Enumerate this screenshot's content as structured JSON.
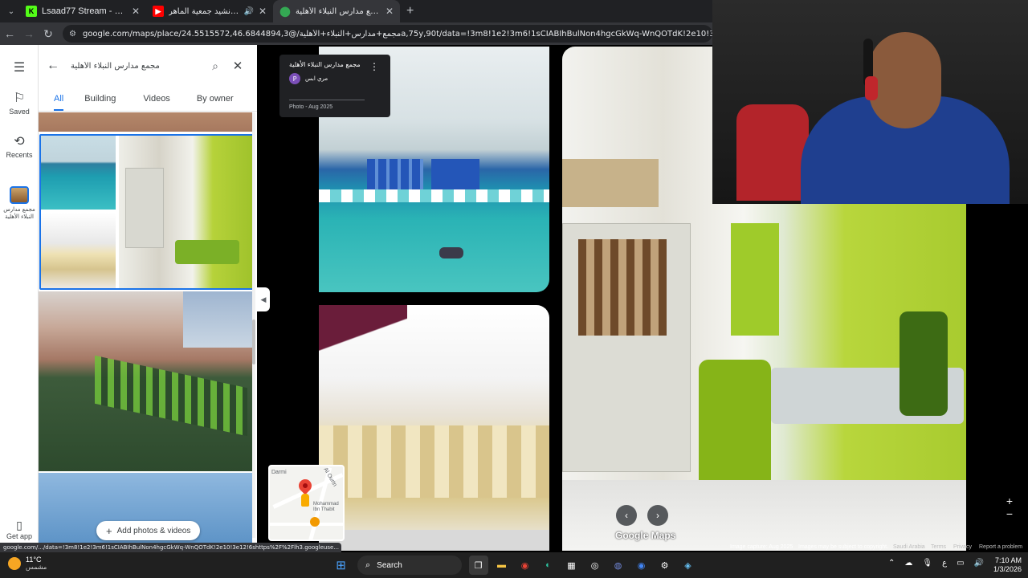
{
  "browser": {
    "tabs": [
      {
        "title": "Lsaad77 Stream - Kick Dashboard",
        "favicon": "kick-icon",
        "color": "#53fc18",
        "active": false
      },
      {
        "title": "الماهر \" | نشيد جمعية الماهر",
        "favicon": "youtube-icon",
        "color": "#ff0000",
        "active": false,
        "muted": true
      },
      {
        "title": "مجمع مدارس النبلاء الأهلية - Google Maps",
        "favicon": "maps-icon",
        "color": "#34a853",
        "active": true
      }
    ],
    "url": "google.com/maps/place/مجمع+مدارس+النبلاء+الأهلية/@24.5515572,46.6844894,3a,75y,90t/data=!3m8!1e2!3m6!1sCIABIhBulNon4hgcGkWq-WnQOTdK!2e10!3e12!6shttps:%2F%2",
    "status_url": "google.com/.../data=!3m8!1e2!3m6!1sCIABIhBulNon4hgcGkWq-WnQOTdK!2e10!3e12!6shttps%2F%2Flh3.googleuse..."
  },
  "maps": {
    "search_value": "مجمع مدارس النبلاء الأهلية",
    "rail": {
      "saved": "Saved",
      "recents": "Recents",
      "place": "مجمع مدارس النبلاء الأهلية",
      "get_app": "Get app"
    },
    "filters": [
      "All",
      "Building",
      "Videos",
      "By owner"
    ],
    "active_filter": "All",
    "add_photos": "Add photos & videos",
    "photo_card": {
      "place": "مجمع مدارس النبلاء الأهلية",
      "user": "مري ابس",
      "avatar_letter": "P",
      "date": "Photo - Aug 2025"
    },
    "minimap": {
      "street1": "Al Ourtn",
      "street2": "Mohammad Ibn Thabit",
      "street3": "Darmi"
    },
    "logo": "Google Maps",
    "attribution": {
      "capture": "Image capture: Aug 2025",
      "copyright": "Images may be subject to copyright.",
      "country": "Saudi Arabia",
      "terms": "Terms",
      "privacy": "Privacy",
      "report": "Report a problem"
    }
  },
  "taskbar": {
    "temp": "11°C",
    "city": "مشمس",
    "search": "Search",
    "time": "7:10 AM",
    "date": "1/3/2026",
    "lang": "ع"
  },
  "colors": {
    "accent": "#1a73e8",
    "pool": "#2ab3b5",
    "grass": "#9acd32"
  }
}
